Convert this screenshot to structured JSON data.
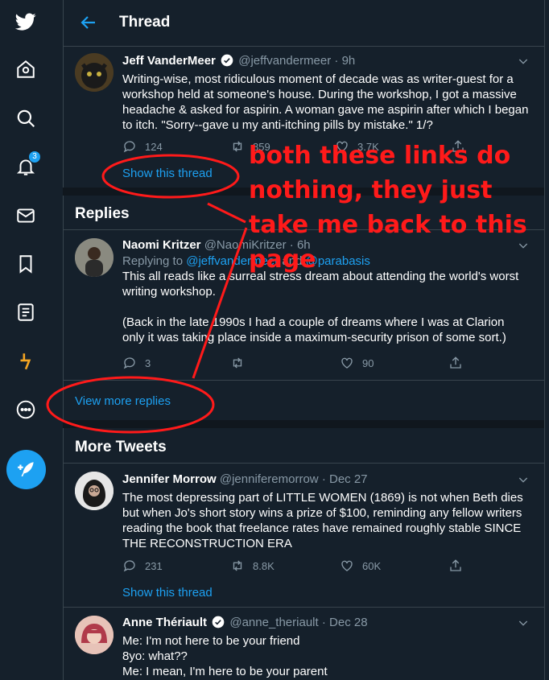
{
  "header": {
    "title": "Thread"
  },
  "sidebar": {
    "notification_count": "3"
  },
  "main_tweet": {
    "name": "Jeff VanderMeer",
    "handle": "@jeffvandermeer",
    "dot": "·",
    "time": "9h",
    "text": "Writing-wise, most ridiculous moment of decade was as writer-guest for a workshop held at someone's house. During the workshop, I got a massive headache & asked for aspirin. A woman gave me aspirin after which I began to itch. \"Sorry--gave u my anti-itching pills by mistake.\" 1/?",
    "replies": "124",
    "retweets": "859",
    "likes": "3.7K",
    "show_thread": "Show this thread"
  },
  "replies_section": {
    "title": "Replies"
  },
  "reply": {
    "name": "Naomi Kritzer",
    "handle": "@NaomiKritzer",
    "dot": "·",
    "time": "6h",
    "replying_prefix": "Replying to ",
    "replying_user1": "@jeffvandermeer",
    "replying_and": " and ",
    "replying_user2": "@parabasis",
    "text1": "This all reads like a surreal stress dream about attending the world's worst writing workshop.",
    "text2": "(Back in the late 1990s I had a couple of dreams where I was at Clarion only it was taking place inside a maximum-security prison of some sort.)",
    "replies": "3",
    "retweets": "",
    "likes": "90",
    "view_more": "View more replies"
  },
  "more_section": {
    "title": "More Tweets"
  },
  "more_tweet1": {
    "name": "Jennifer Morrow",
    "handle": "@jenniferemorrow",
    "dot": "·",
    "time": "Dec 27",
    "text": "The most depressing part of LITTLE WOMEN (1869) is not when Beth dies but when Jo's short story wins a prize of $100, reminding any fellow writers reading the book that freelance rates have remained roughly stable SINCE THE RECONSTRUCTION ERA",
    "replies": "231",
    "retweets": "8.8K",
    "likes": "60K",
    "show_thread": "Show this thread"
  },
  "more_tweet2": {
    "name": "Anne Thériault",
    "handle": "@anne_theriault",
    "dot": "·",
    "time": "Dec 28",
    "line1": "Me: I'm not here to be your friend",
    "line2": "8yo: what??",
    "line3": "Me: I mean, I'm here to be your parent"
  },
  "annotation": {
    "text": "both these links do nothing, they just take me back to this page",
    "color": "#ff1a1a"
  },
  "colors": {
    "background": "#15202b",
    "accent": "#1da1f2",
    "muted": "#8899a6",
    "border": "#38444d"
  }
}
